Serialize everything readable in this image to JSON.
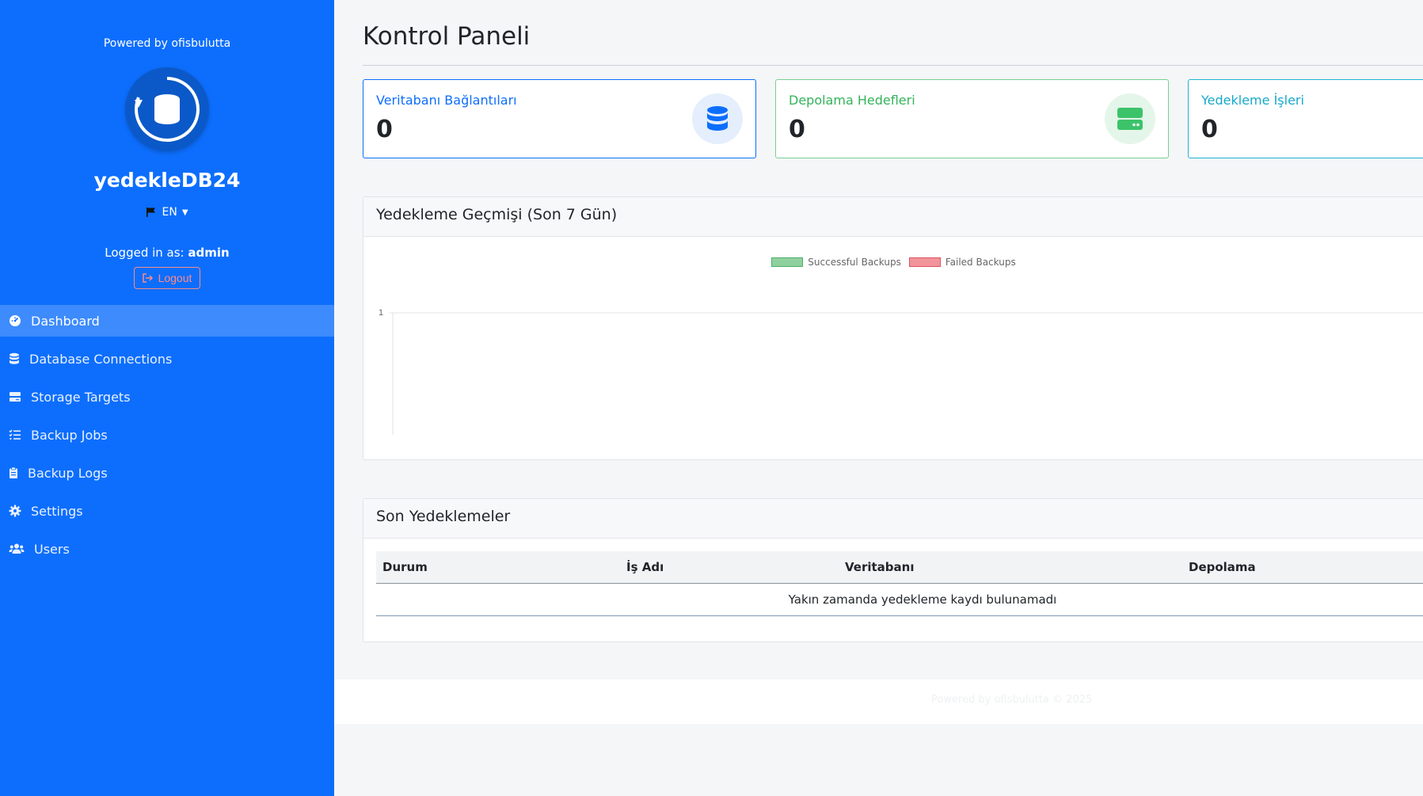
{
  "sidebar": {
    "powered_by": "Powered by ofisbulutta",
    "app_name": "yedekleDB24",
    "language": "EN",
    "logged_in_prefix": "Logged in as:",
    "username": "admin",
    "logout_label": "Logout",
    "items": [
      {
        "label": "Dashboard",
        "icon": "dashboard-icon",
        "active": true
      },
      {
        "label": "Database Connections",
        "icon": "database-icon"
      },
      {
        "label": "Storage Targets",
        "icon": "hdd-icon"
      },
      {
        "label": "Backup Jobs",
        "icon": "list-check-icon"
      },
      {
        "label": "Backup Logs",
        "icon": "clipboard-icon"
      },
      {
        "label": "Settings",
        "icon": "gear-icon"
      },
      {
        "label": "Users",
        "icon": "users-icon"
      }
    ]
  },
  "main": {
    "title": "Kontrol Paneli",
    "stats": [
      {
        "label": "Veritabanı Bağlantıları",
        "value": "0",
        "color": "#0d6efd",
        "icon": "database-icon"
      },
      {
        "label": "Depolama Hedefleri",
        "value": "0",
        "color": "#33b35a",
        "icon": "hdd-icon"
      },
      {
        "label": "Yedekleme İşleri",
        "value": "0",
        "color": "#17a8c9"
      }
    ],
    "chart_card_title": "Yedekleme Geçmişi (Son 7 Gün)",
    "recent_card_title": "Son Yedeklemeler",
    "table": {
      "headers": [
        "Durum",
        "İş Adı",
        "Veritabanı",
        "Depolama"
      ],
      "empty_message": "Yakın zamanda yedekleme kaydı bulunamadı"
    },
    "footer_text": "Powered by ofisbulutta © 2025"
  },
  "chart_data": {
    "type": "bar",
    "categories": [],
    "series": [
      {
        "name": "Successful Backups",
        "values": [],
        "color": "#8fd19e"
      },
      {
        "name": "Failed Backups",
        "values": [],
        "color": "#f1959b"
      }
    ],
    "yticks": [
      "1",
      "0"
    ],
    "ylim": [
      0,
      1
    ],
    "legend": "top-center"
  }
}
